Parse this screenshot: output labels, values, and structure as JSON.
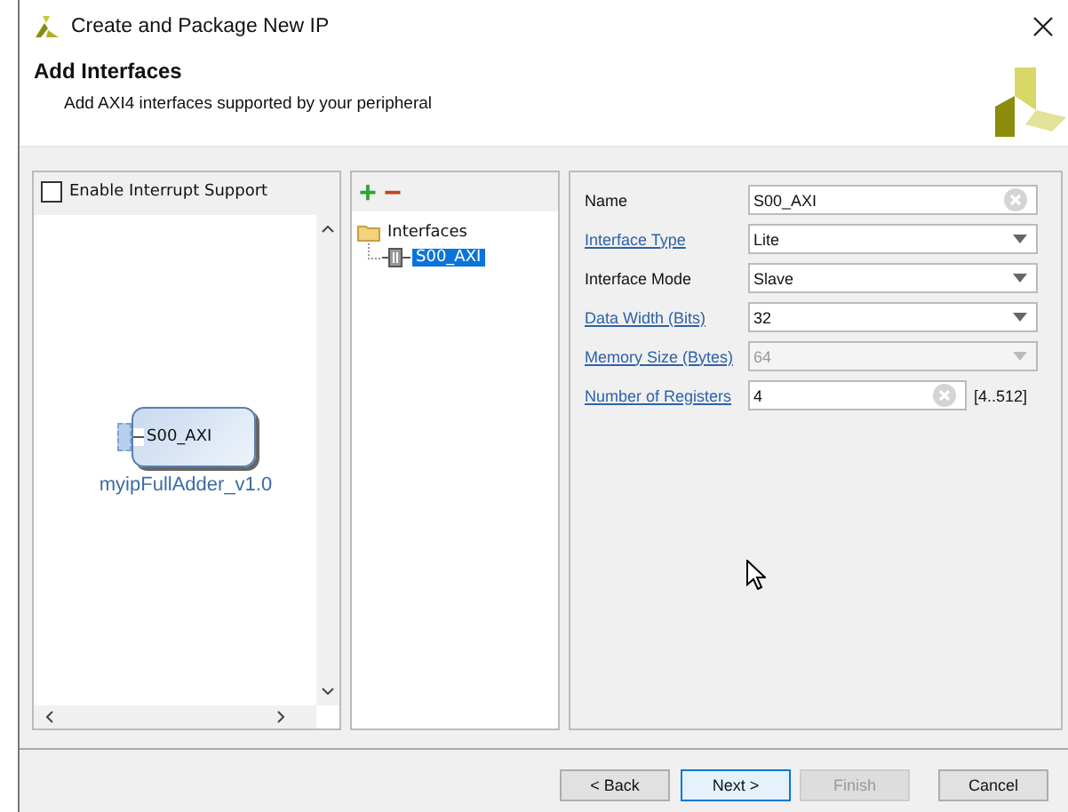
{
  "window": {
    "title": "Create and Package New IP"
  },
  "header": {
    "title": "Add Interfaces",
    "subtitle": "Add AXI4 interfaces supported by your peripheral"
  },
  "interrupt": {
    "label": "Enable Interrupt Support",
    "checked": false
  },
  "block": {
    "port": "S00_AXI",
    "name": "myipFullAdder_v1.0"
  },
  "tree": {
    "toolbar": [
      "+",
      "−"
    ],
    "root": {
      "label": "Interfaces",
      "expanded": true,
      "children": [
        {
          "label": "S00_AXI",
          "selected": true
        }
      ]
    }
  },
  "fields": [
    {
      "label": "Name",
      "link": false,
      "kind": "text",
      "value": "S00_AXI",
      "disabled": false
    },
    {
      "label": "Interface Type",
      "link": true,
      "kind": "dropdown",
      "value": "Lite",
      "disabled": false
    },
    {
      "label": "Interface Mode",
      "link": false,
      "kind": "dropdown",
      "value": "Slave",
      "disabled": false
    },
    {
      "label": "Data Width (Bits)",
      "link": true,
      "kind": "dropdown",
      "value": "32",
      "disabled": false
    },
    {
      "label": "Memory Size (Bytes)",
      "link": true,
      "kind": "dropdown",
      "value": "64",
      "disabled": true
    },
    {
      "label": "Number of Registers",
      "link": true,
      "kind": "text",
      "value": "4",
      "disabled": false,
      "range": "[4..512]"
    }
  ],
  "buttons": [
    {
      "label": "< Back",
      "disabled": false,
      "selected": false
    },
    {
      "label": "Next >",
      "disabled": false,
      "selected": true
    },
    {
      "label": "Finish",
      "disabled": true,
      "selected": false
    },
    {
      "label": "Cancel",
      "disabled": false,
      "selected": false
    }
  ]
}
